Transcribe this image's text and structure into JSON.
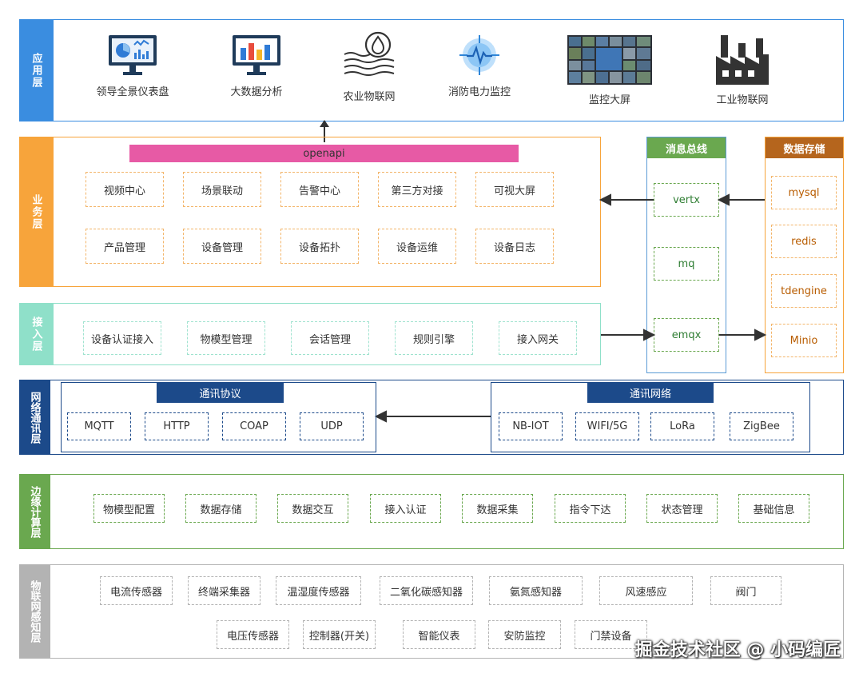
{
  "colors": {
    "app": "#3a8de0",
    "business": "#f7a43b",
    "access": "#8fe0c9",
    "network": "#1c4a8a",
    "edge": "#6aa84f",
    "iot": "#b3b3b3",
    "bus": "#6aa84f",
    "storage": "#b5651d",
    "openapi": "#e75aa5"
  },
  "app_layer": {
    "title": "应用层",
    "items": [
      {
        "label": "领导全景仪表盘",
        "icon": "dashboard-monitor-icon"
      },
      {
        "label": "大数据分析",
        "icon": "bar-chart-monitor-icon"
      },
      {
        "label": "农业物联网",
        "icon": "water-drop-soil-icon"
      },
      {
        "label": "消防电力监控",
        "icon": "pulse-target-icon"
      },
      {
        "label": "监控大屏",
        "icon": "video-wall-icon"
      },
      {
        "label": "工业物联网",
        "icon": "factory-icon"
      }
    ]
  },
  "business_layer": {
    "title": "业务层",
    "openapi": "openapi",
    "row1": [
      "视频中心",
      "场景联动",
      "告警中心",
      "第三方对接",
      "可视大屏"
    ],
    "row2": [
      "产品管理",
      "设备管理",
      "设备拓扑",
      "设备运维",
      "设备日志"
    ]
  },
  "access_layer": {
    "title": "接入层",
    "items": [
      "设备认证接入",
      "物模型管理",
      "会话管理",
      "规则引擎",
      "接入网关"
    ]
  },
  "message_bus": {
    "title": "消息总线",
    "items": [
      "vertx",
      "mq",
      "emqx"
    ]
  },
  "data_storage": {
    "title": "数据存储",
    "items": [
      "mysql",
      "redis",
      "tdengine",
      "Minio"
    ]
  },
  "network_layer": {
    "title": "网络通讯层",
    "protocols": {
      "title": "通讯协议",
      "items": [
        "MQTT",
        "HTTP",
        "COAP",
        "UDP"
      ]
    },
    "networks": {
      "title": "通讯网络",
      "items": [
        "NB-IOT",
        "WIFI/5G",
        "LoRa",
        "ZigBee"
      ]
    }
  },
  "edge_layer": {
    "title": "边缘计算层",
    "items": [
      "物模型配置",
      "数据存储",
      "数据交互",
      "接入认证",
      "数据采集",
      "指令下达",
      "状态管理",
      "基础信息"
    ]
  },
  "iot_layer": {
    "title": "物联网感知层",
    "row1": [
      "电流传感器",
      "终端采集器",
      "温湿度传感器",
      "二氧化碳感知器",
      "氨氮感知器",
      "风速感应",
      "阀门"
    ],
    "row2": [
      "电压传感器",
      "控制器(开关)",
      "智能仪表",
      "安防监控",
      "门禁设备"
    ]
  },
  "watermark": "掘金技术社区 @ 小码编匠"
}
